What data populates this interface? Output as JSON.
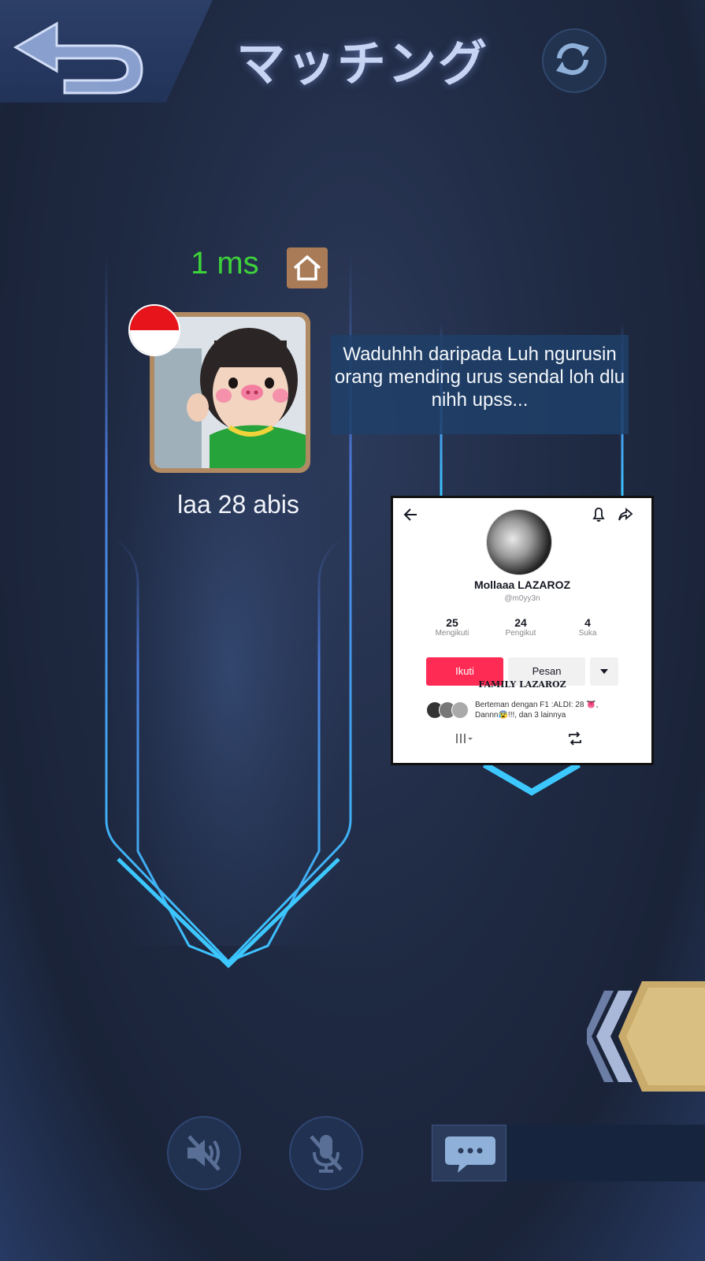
{
  "header": {
    "title": "マッチング",
    "back_icon": "back-arrow-icon",
    "refresh_icon": "refresh-icon"
  },
  "player": {
    "ping": "1 ms",
    "ping_color": "#3ed23a",
    "host_icon": "home-icon",
    "flag": "indonesia-flag",
    "name": "laa 28 abis",
    "chat_bubble": "Waduhhh daripada Luh ngurusin orang mending urus sendal loh dlu nihh upss..."
  },
  "profile_card": {
    "display_name": "Mollaaa LAZAROZ",
    "username": "@m0yy3n",
    "stats": [
      {
        "value": "25",
        "label": "Mengikuti"
      },
      {
        "value": "24",
        "label": "Pengikut"
      },
      {
        "value": "4",
        "label": "Suka"
      }
    ],
    "follow_label": "Ikuti",
    "message_label": "Pesan",
    "bio": "FAMILY LAZAROZ",
    "friends_line1": "Berteman dengan F1 :ALDI: 28 👅,",
    "friends_line2": "Dannn😰!!!, dan 3 lainnya",
    "accent": "#fe2c55"
  },
  "bottom": {
    "speaker_icon": "speaker-muted-icon",
    "mic_icon": "mic-muted-icon",
    "chat_icon": "chat-icon"
  }
}
